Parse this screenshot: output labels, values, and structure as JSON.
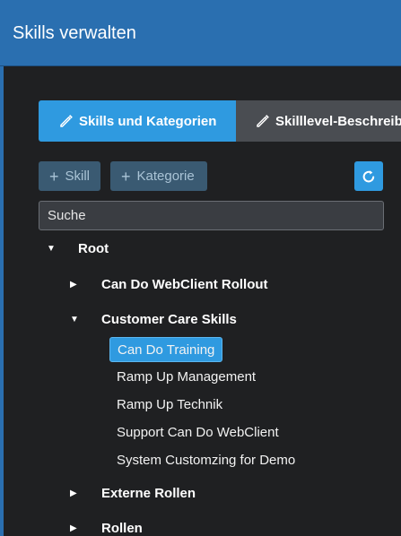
{
  "header": {
    "title": "Skills verwalten"
  },
  "tabs": [
    {
      "label": "Skills und Kategorien",
      "active": true,
      "icon": "pencil-icon"
    },
    {
      "label": "Skilllevel-Beschreib",
      "active": false,
      "icon": "pencil-icon"
    }
  ],
  "toolbar": {
    "add_skill_label": "Skill",
    "add_category_label": "Kategorie",
    "refresh_icon": "refresh-icon"
  },
  "search": {
    "placeholder": "Suche",
    "value": ""
  },
  "tree": {
    "root": {
      "label": "Root",
      "expanded": true
    },
    "categories": [
      {
        "label": "Can Do WebClient Rollout",
        "expanded": false
      },
      {
        "label": "Customer Care Skills",
        "expanded": true,
        "children": [
          {
            "label": "Can Do Training",
            "selected": true
          },
          {
            "label": "Ramp Up Management",
            "selected": false
          },
          {
            "label": "Ramp Up Technik",
            "selected": false
          },
          {
            "label": "Support Can Do WebClient",
            "selected": false
          },
          {
            "label": "System Customzing for Demo",
            "selected": false
          }
        ]
      },
      {
        "label": "Externe Rollen",
        "expanded": false
      },
      {
        "label": "Rollen",
        "expanded": false
      }
    ]
  },
  "colors": {
    "header": "#2a6fb0",
    "accent": "#2f9ae0",
    "background": "#1f2022",
    "inactive_tab": "#4a4d52"
  }
}
